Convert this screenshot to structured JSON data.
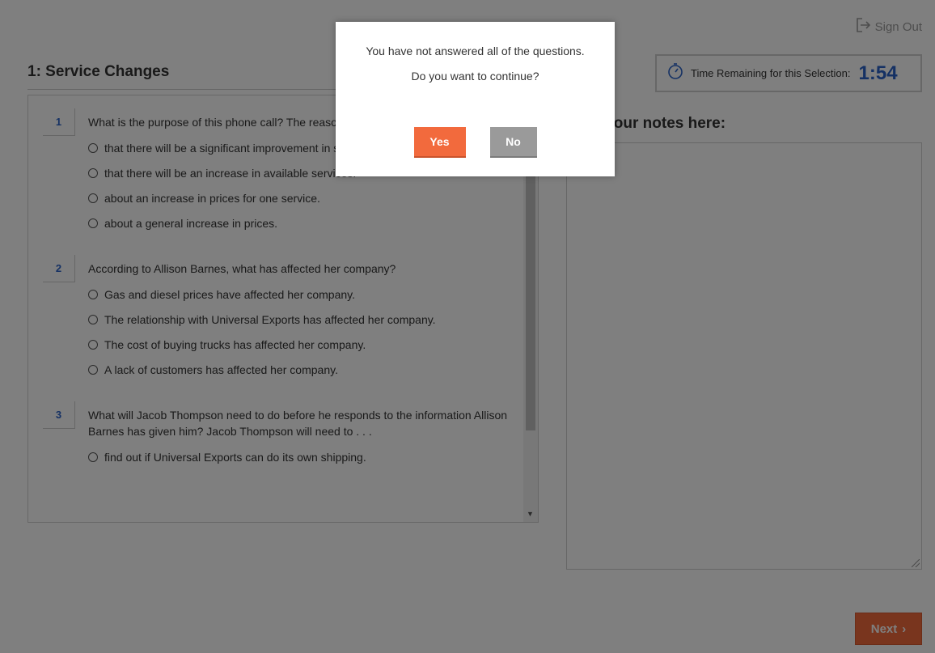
{
  "header": {
    "sign_out_label": "Sign Out"
  },
  "section": {
    "title": "1: Service Changes"
  },
  "timer": {
    "label": "Time Remaining for this Selection:",
    "value": "1:54"
  },
  "questions": [
    {
      "number": "1",
      "text": "What is the purpose of this phone call? The reason for this call is to inform a client . . .",
      "options": [
        "that there will be a significant improvement in service.",
        "that there will be an increase in available services.",
        "about an increase in prices for one service.",
        "about a general increase in prices."
      ]
    },
    {
      "number": "2",
      "text": "According to Allison Barnes, what has affected her company?",
      "options": [
        "Gas and diesel prices have affected her company.",
        "The relationship with Universal Exports has affected her company.",
        "The cost of buying trucks has affected her company.",
        "A lack of customers has affected her company."
      ]
    },
    {
      "number": "3",
      "text": "What will Jacob Thompson need to do before he responds to the information Allison Barnes has given him? Jacob Thompson will need to . . .",
      "options": [
        "find out if Universal Exports can do its own shipping."
      ]
    }
  ],
  "notes": {
    "title": "Type your notes here:"
  },
  "footer": {
    "next_label": "Next",
    "next_arrow": "›"
  },
  "dialog": {
    "message": "You have not answered all of the questions.",
    "question": "Do you want to continue?",
    "yes_label": "Yes",
    "no_label": "No"
  },
  "colors": {
    "accent": "#f26a3d",
    "link_blue": "#2a63c8",
    "overlay": "rgba(0,0,0,0.5)"
  }
}
